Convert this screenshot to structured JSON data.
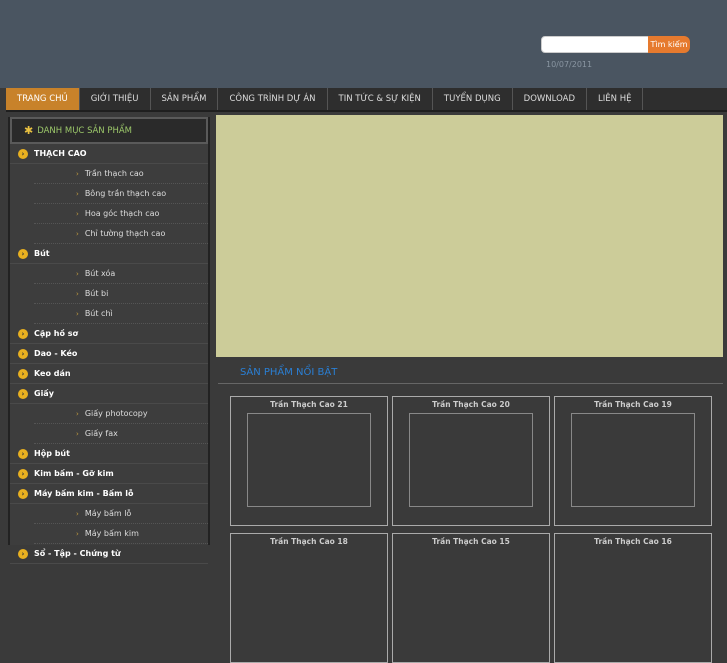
{
  "header": {
    "search_placeholder": "",
    "search_button": "Tìm kiếm",
    "date": "10/07/2011"
  },
  "nav": [
    "TRANG CHỦ",
    "GIỚI THIỆU",
    "SẢN PHẨM",
    "CÔNG TRÌNH DỰ ÁN",
    "TIN TỨC & SỰ KIỆN",
    "TUYỂN DỤNG",
    "DOWNLOAD",
    "LIÊN HỆ"
  ],
  "sidebar": {
    "title": "DANH MỤC SẢN PHẨM",
    "cat1": "THẠCH CAO",
    "cat1_subs": [
      "Trần thạch cao",
      "Bông trần thạch cao",
      "Hoa góc thạch cao",
      "Chỉ tường thạch cao"
    ],
    "cat2": "Bút",
    "cat2_subs": [
      "Bút xóa",
      "Bút bi",
      "Bút chì"
    ],
    "cat3": "Cặp hồ sơ",
    "cat4": "Dao - Kéo",
    "cat5": "Keo dán",
    "cat6": "Giấy",
    "cat6_subs": [
      "Giấy photocopy",
      "Giấy fax"
    ],
    "cat7": "Hộp bút",
    "cat8": "Kim bấm - Gỡ kim",
    "cat9": "Máy bấm kim - Bấm lỗ",
    "cat9_subs": [
      "Máy bấm lỗ",
      "Máy bấm kim"
    ],
    "cat10": "Sổ - Tập - Chứng từ"
  },
  "featured": {
    "title": "SẢN PHẨM NỔI BẬT",
    "products": [
      "Trần Thạch Cao 21",
      "Trần Thạch Cao 20",
      "Trần Thạch Cao 19",
      "Trần Thạch Cao 18",
      "Trần Thạch Cao 15",
      "Trần Thạch Cao 16"
    ]
  },
  "colors": {
    "accent": "#c8822a",
    "header": "#4a5561",
    "banner": "#cccc99",
    "featured_title": "#2a7fd4"
  }
}
